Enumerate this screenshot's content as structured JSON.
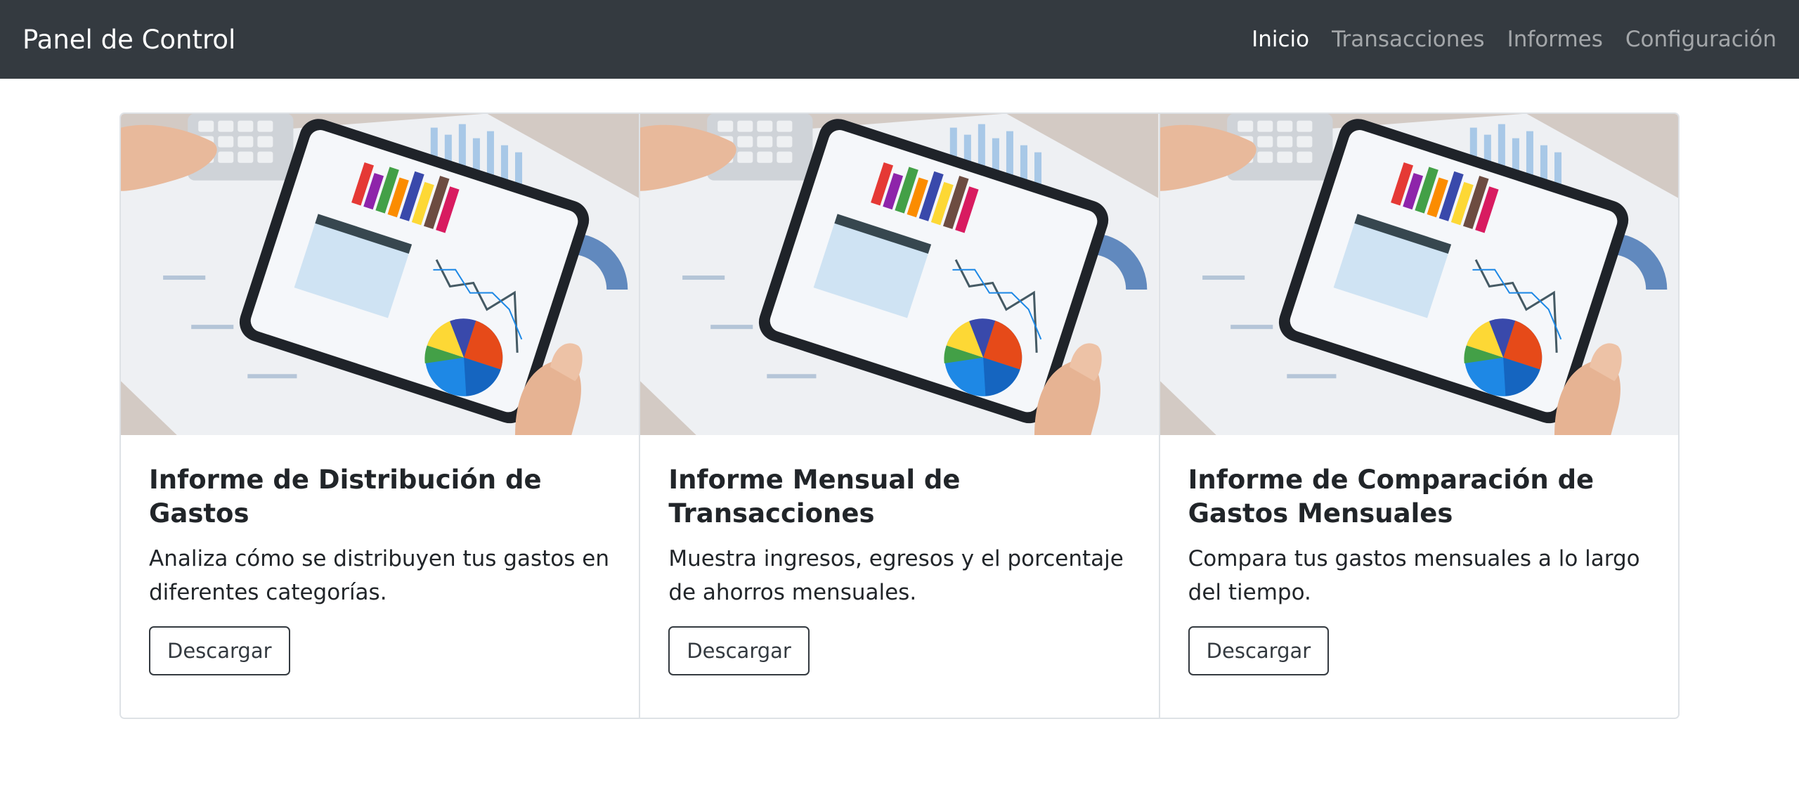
{
  "navbar": {
    "brand": "Panel de Control",
    "links": [
      "Inicio",
      "Transacciones",
      "Informes",
      "Configuración"
    ]
  },
  "cards": [
    {
      "title": "Informe de Distribución de Gastos",
      "text": "Analiza cómo se distribuyen tus gastos en diferentes categorías.",
      "button": "Descargar"
    },
    {
      "title": "Informe Mensual de Transacciones",
      "text": "Muestra ingresos, egresos y el porcentaje de ahorros mensuales.",
      "button": "Descargar"
    },
    {
      "title": "Informe de Comparación de Gastos Mensuales",
      "text": "Compara tus gastos mensuales a lo largo del tiempo.",
      "button": "Descargar"
    }
  ],
  "colors": {
    "navbar_bg": "#343a40",
    "nav_active": "#ffffff",
    "nav_inactive": "rgba(255,255,255,0.55)",
    "button_border": "#343a40"
  }
}
